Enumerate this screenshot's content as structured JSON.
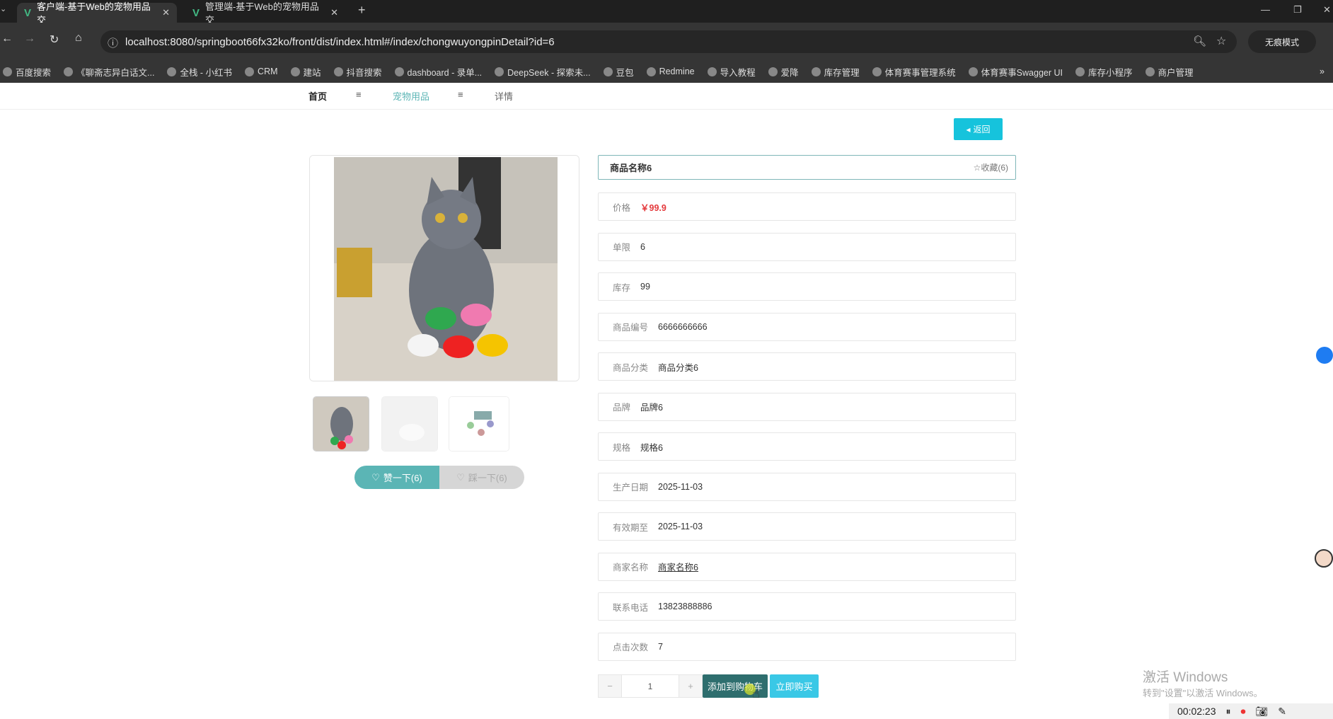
{
  "browser": {
    "tabs": [
      {
        "title": "客户端-基于Web的宠物用品交",
        "active": true
      },
      {
        "title": "管理端-基于Web的宠物用品交",
        "active": false
      }
    ],
    "url": "localhost:8080/springboot66fx32ko/front/dist/index.html#/index/chongwuyongpinDetail?id=6",
    "incognito_label": "无痕模式",
    "bookmarks": [
      "百度搜索",
      "《聊斋志异白话文...",
      "全栈 - 小红书",
      "CRM",
      "建站",
      "抖音搜索",
      "dashboard - 录单...",
      "DeepSeek - 探索未...",
      "豆包",
      "Redmine",
      "导入教程",
      "爱降",
      "库存管理",
      "体育赛事管理系统",
      "体育赛事Swagger UI",
      "库存小程序",
      "商户管理"
    ]
  },
  "breadcrumb": {
    "home": "首页",
    "sep": "≡",
    "category": "宠物用品",
    "current": "详情"
  },
  "back_label": "返回",
  "product": {
    "name": "商品名称6",
    "favorite_label": "☆收藏(6)",
    "fields": [
      {
        "label": "价格",
        "value": "￥99.9"
      },
      {
        "label": "单限",
        "value": "6"
      },
      {
        "label": "库存",
        "value": "99"
      },
      {
        "label": "商品编号",
        "value": "6666666666"
      },
      {
        "label": "商品分类",
        "value": "商品分类6"
      },
      {
        "label": "品牌",
        "value": "品牌6"
      },
      {
        "label": "规格",
        "value": "规格6"
      },
      {
        "label": "生产日期",
        "value": "2025-11-03"
      },
      {
        "label": "有效期至",
        "value": "2025-11-03"
      },
      {
        "label": "商家名称",
        "value": "商家名称6"
      },
      {
        "label": "联系电话",
        "value": "13823888886"
      },
      {
        "label": "点击次数",
        "value": "7"
      }
    ],
    "like_label": "赞一下(6)",
    "dislike_label": "踩一下(6)",
    "quantity": "1",
    "minus": "−",
    "plus": "+",
    "add_cart_label": "添加到购物车",
    "buy_label": "立即购买",
    "price_color": "#e4393c",
    "accent": "#5bb5b5"
  },
  "watermark": {
    "line1": "激活 Windows",
    "line2": "转到\"设置\"以激活 Windows。"
  },
  "recorder": {
    "time": "00:02:23"
  }
}
